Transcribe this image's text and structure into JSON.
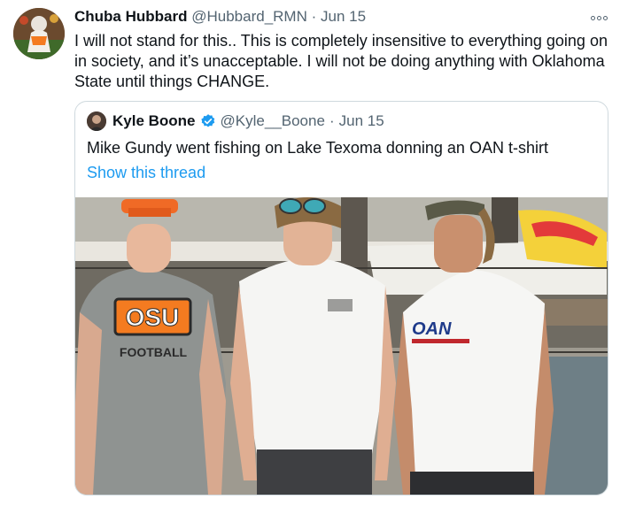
{
  "tweet": {
    "author_name": "Chuba Hubbard",
    "handle": "@Hubbard_RMN",
    "separator": "·",
    "date": "Jun 15",
    "text": "I will not stand for this.. This is completely insensitive to everything going on in society, and it’s unacceptable. I will not be doing anything with Oklahoma State until things CHANGE."
  },
  "quoted": {
    "author_name": "Kyle Boone",
    "handle": "@Kyle__Boone",
    "separator": "·",
    "date": "Jun 15",
    "text": "Mike Gundy went fishing on Lake Texoma donning an OAN t-shirt",
    "show_thread": "Show this thread"
  },
  "photo": {
    "shirt_left_logo": "OSU",
    "shirt_left_text": "FOOTBALL",
    "shirt_right_logo": "OAN"
  },
  "colors": {
    "link": "#1d9bf0",
    "muted": "#536471",
    "border": "#cfd9de",
    "verified": "#1d9bf0"
  }
}
